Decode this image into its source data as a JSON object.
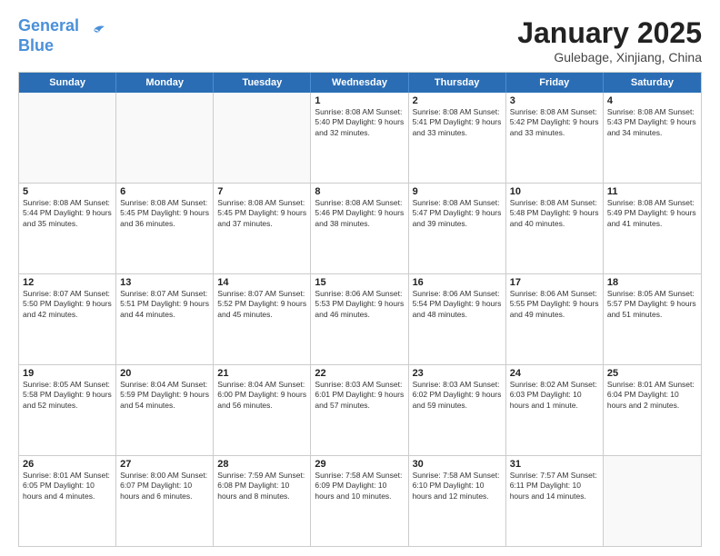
{
  "header": {
    "logo_line1": "General",
    "logo_line2": "Blue",
    "month": "January 2025",
    "location": "Gulebage, Xinjiang, China"
  },
  "weekdays": [
    "Sunday",
    "Monday",
    "Tuesday",
    "Wednesday",
    "Thursday",
    "Friday",
    "Saturday"
  ],
  "rows": [
    [
      {
        "day": "",
        "text": "",
        "empty": true
      },
      {
        "day": "",
        "text": "",
        "empty": true
      },
      {
        "day": "",
        "text": "",
        "empty": true
      },
      {
        "day": "1",
        "text": "Sunrise: 8:08 AM\nSunset: 5:40 PM\nDaylight: 9 hours and 32 minutes."
      },
      {
        "day": "2",
        "text": "Sunrise: 8:08 AM\nSunset: 5:41 PM\nDaylight: 9 hours and 33 minutes."
      },
      {
        "day": "3",
        "text": "Sunrise: 8:08 AM\nSunset: 5:42 PM\nDaylight: 9 hours and 33 minutes."
      },
      {
        "day": "4",
        "text": "Sunrise: 8:08 AM\nSunset: 5:43 PM\nDaylight: 9 hours and 34 minutes."
      }
    ],
    [
      {
        "day": "5",
        "text": "Sunrise: 8:08 AM\nSunset: 5:44 PM\nDaylight: 9 hours and 35 minutes."
      },
      {
        "day": "6",
        "text": "Sunrise: 8:08 AM\nSunset: 5:45 PM\nDaylight: 9 hours and 36 minutes."
      },
      {
        "day": "7",
        "text": "Sunrise: 8:08 AM\nSunset: 5:45 PM\nDaylight: 9 hours and 37 minutes."
      },
      {
        "day": "8",
        "text": "Sunrise: 8:08 AM\nSunset: 5:46 PM\nDaylight: 9 hours and 38 minutes."
      },
      {
        "day": "9",
        "text": "Sunrise: 8:08 AM\nSunset: 5:47 PM\nDaylight: 9 hours and 39 minutes."
      },
      {
        "day": "10",
        "text": "Sunrise: 8:08 AM\nSunset: 5:48 PM\nDaylight: 9 hours and 40 minutes."
      },
      {
        "day": "11",
        "text": "Sunrise: 8:08 AM\nSunset: 5:49 PM\nDaylight: 9 hours and 41 minutes."
      }
    ],
    [
      {
        "day": "12",
        "text": "Sunrise: 8:07 AM\nSunset: 5:50 PM\nDaylight: 9 hours and 42 minutes."
      },
      {
        "day": "13",
        "text": "Sunrise: 8:07 AM\nSunset: 5:51 PM\nDaylight: 9 hours and 44 minutes."
      },
      {
        "day": "14",
        "text": "Sunrise: 8:07 AM\nSunset: 5:52 PM\nDaylight: 9 hours and 45 minutes."
      },
      {
        "day": "15",
        "text": "Sunrise: 8:06 AM\nSunset: 5:53 PM\nDaylight: 9 hours and 46 minutes."
      },
      {
        "day": "16",
        "text": "Sunrise: 8:06 AM\nSunset: 5:54 PM\nDaylight: 9 hours and 48 minutes."
      },
      {
        "day": "17",
        "text": "Sunrise: 8:06 AM\nSunset: 5:55 PM\nDaylight: 9 hours and 49 minutes."
      },
      {
        "day": "18",
        "text": "Sunrise: 8:05 AM\nSunset: 5:57 PM\nDaylight: 9 hours and 51 minutes."
      }
    ],
    [
      {
        "day": "19",
        "text": "Sunrise: 8:05 AM\nSunset: 5:58 PM\nDaylight: 9 hours and 52 minutes."
      },
      {
        "day": "20",
        "text": "Sunrise: 8:04 AM\nSunset: 5:59 PM\nDaylight: 9 hours and 54 minutes."
      },
      {
        "day": "21",
        "text": "Sunrise: 8:04 AM\nSunset: 6:00 PM\nDaylight: 9 hours and 56 minutes."
      },
      {
        "day": "22",
        "text": "Sunrise: 8:03 AM\nSunset: 6:01 PM\nDaylight: 9 hours and 57 minutes."
      },
      {
        "day": "23",
        "text": "Sunrise: 8:03 AM\nSunset: 6:02 PM\nDaylight: 9 hours and 59 minutes."
      },
      {
        "day": "24",
        "text": "Sunrise: 8:02 AM\nSunset: 6:03 PM\nDaylight: 10 hours and 1 minute."
      },
      {
        "day": "25",
        "text": "Sunrise: 8:01 AM\nSunset: 6:04 PM\nDaylight: 10 hours and 2 minutes."
      }
    ],
    [
      {
        "day": "26",
        "text": "Sunrise: 8:01 AM\nSunset: 6:05 PM\nDaylight: 10 hours and 4 minutes."
      },
      {
        "day": "27",
        "text": "Sunrise: 8:00 AM\nSunset: 6:07 PM\nDaylight: 10 hours and 6 minutes."
      },
      {
        "day": "28",
        "text": "Sunrise: 7:59 AM\nSunset: 6:08 PM\nDaylight: 10 hours and 8 minutes."
      },
      {
        "day": "29",
        "text": "Sunrise: 7:58 AM\nSunset: 6:09 PM\nDaylight: 10 hours and 10 minutes."
      },
      {
        "day": "30",
        "text": "Sunrise: 7:58 AM\nSunset: 6:10 PM\nDaylight: 10 hours and 12 minutes."
      },
      {
        "day": "31",
        "text": "Sunrise: 7:57 AM\nSunset: 6:11 PM\nDaylight: 10 hours and 14 minutes."
      },
      {
        "day": "",
        "text": "",
        "empty": true
      }
    ]
  ]
}
